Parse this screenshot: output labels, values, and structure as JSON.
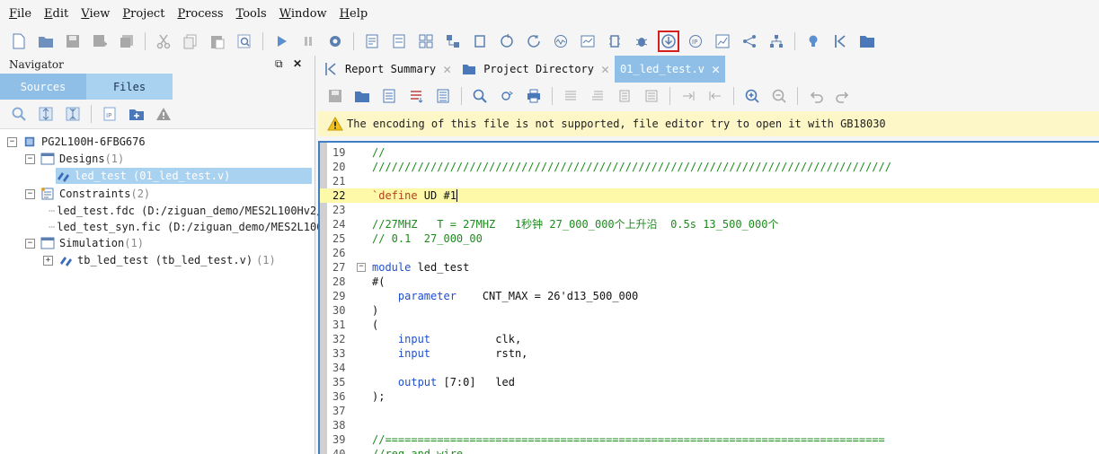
{
  "menu": [
    {
      "u": "F",
      "rest": "ile"
    },
    {
      "u": "E",
      "rest": "dit"
    },
    {
      "u": "V",
      "rest": "iew"
    },
    {
      "u": "P",
      "rest": "roject"
    },
    {
      "u": "P",
      "rest": "rocess"
    },
    {
      "u": "T",
      "rest": "ools"
    },
    {
      "u": "W",
      "rest": "indow"
    },
    {
      "u": "H",
      "rest": "elp"
    }
  ],
  "navigator": {
    "title": "Navigator",
    "tabs": [
      "Sources",
      "Files"
    ],
    "tree": {
      "device": "PG2L100H-6FBG676",
      "designs_label": "Designs",
      "designs_count": "(1)",
      "design_item": "led_test (01_led_test.v)",
      "constraints_label": "Constraints",
      "constraints_count": "(2)",
      "constraint_1": "led_test.fdc (D:/ziguan_demo/MES2L100Hv2/",
      "constraint_2": "led_test_syn.fic (D:/ziguan_demo/MES2L100",
      "simulation_label": "Simulation",
      "simulation_count": "(1)",
      "sim_item": "tb_led_test (tb_led_test.v)",
      "sim_item_count": "(1)"
    }
  },
  "editor_tabs": [
    {
      "label": "Report Summary",
      "active": false
    },
    {
      "label": "Project Directory",
      "active": false
    },
    {
      "label": "01_led_test.v",
      "active": true
    }
  ],
  "warning": "The encoding of this file is not supported, file editor try to open it with GB18030",
  "code": {
    "l19": "//",
    "l20": "////////////////////////////////////////////////////////////////////////////////",
    "l22_dir": "`define",
    "l22_rest": " UD #1",
    "l24": "//27MHZ   T = 27MHZ   1秒钟 27_000_000个上升沿  0.5s 13_500_000个",
    "l25": "// 0.1  27_000_00",
    "l27_kw": "module",
    "l27_rest": " led_test",
    "l28": "#(",
    "l29_kw": "    parameter",
    "l29_rest": "    CNT_MAX = 26'd13_500_000",
    "l30": ")",
    "l31": "(",
    "l32_kw": "    input",
    "l32_rest": "          clk,",
    "l33_kw": "    input",
    "l33_rest": "          rstn,",
    "l35_kw": "    output",
    "l35_rest": " [7:0]   led",
    "l36": ");",
    "l39": "//=============================================================================",
    "l40": "//reg and wire",
    "line_numbers": [
      "19",
      "20",
      "21",
      "22",
      "23",
      "24",
      "25",
      "26",
      "27",
      "28",
      "29",
      "30",
      "31",
      "32",
      "33",
      "34",
      "35",
      "36",
      "37",
      "38",
      "39",
      "40"
    ]
  }
}
